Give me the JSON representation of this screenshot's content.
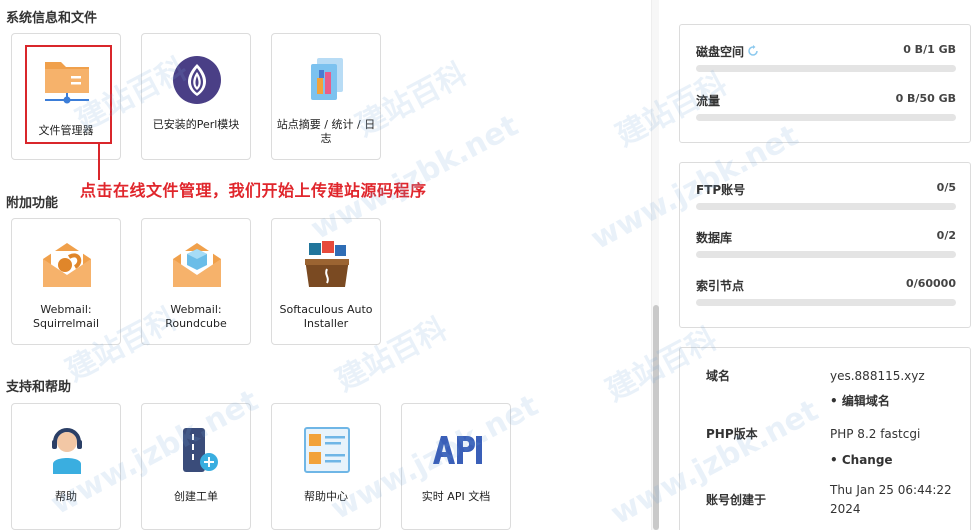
{
  "sections": {
    "system": "系统信息和文件",
    "addons": "附加功能",
    "support": "支持和帮助"
  },
  "tiles": {
    "file_manager": "文件管理器",
    "perl_modules": "已安装的Perl模块",
    "site_summary": "站点摘要 / 统计 / 日志",
    "squirrelmail": "Webmail: Squirrelmail",
    "roundcube": "Webmail: Roundcube",
    "softaculous": "Softaculous Auto Installer",
    "help": "帮助",
    "create_ticket": "创建工单",
    "help_center": "帮助中心",
    "api_docs": "实时 API 文档"
  },
  "icons": {
    "file_manager": "folder-network-icon",
    "perl_modules": "onion-icon",
    "site_summary": "stats-documents-icon",
    "squirrelmail": "squirrel-envelope-icon",
    "roundcube": "cube-envelope-icon",
    "softaculous": "app-box-icon",
    "help": "headset-agent-icon",
    "create_ticket": "ticket-add-icon",
    "help_center": "qa-board-icon",
    "api_docs": "api-text-icon"
  },
  "annotation": "点击在线文件管理，我们开始上传建站源码程序",
  "usage": {
    "disk": {
      "label": "磁盘空间",
      "value": "0 B/1 GB",
      "fraction": 0
    },
    "traffic": {
      "label": "流量",
      "value": "0 B/50 GB",
      "fraction": 0
    },
    "ftp": {
      "label": "FTP账号",
      "value": "0/5",
      "fraction": 0
    },
    "databases": {
      "label": "数据库",
      "value": "0/2",
      "fraction": 0
    },
    "inodes": {
      "label": "索引节点",
      "value": "0/60000",
      "fraction": 0
    }
  },
  "account": {
    "domain_label": "域名",
    "domain_value": "yes.888115.xyz",
    "domain_edit": "• 编辑域名",
    "php_label": "PHP版本",
    "php_value": "PHP 8.2 fastcgi",
    "php_change": "• Change",
    "created_label": "账号创建于",
    "created_line1": "Thu Jan 25 06:44:22",
    "created_line2": "2024"
  },
  "watermarks": [
    "建站百科",
    "www.jzbk.net"
  ],
  "colors": {
    "accent_red": "#e0262c",
    "link_blue": "#2a9fd6",
    "bar_gray": "#e4e4e4"
  }
}
